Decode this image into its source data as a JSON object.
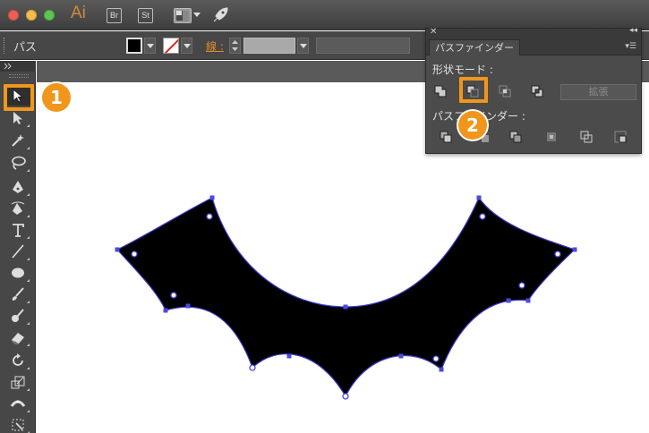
{
  "app": {
    "logo": "Ai",
    "bridge": "Br",
    "stock": "St"
  },
  "control": {
    "object_label": "パス",
    "stroke_label": "線 :"
  },
  "pathfinder": {
    "tab": "パスファインダー",
    "shape_modes_label": "形状モード :",
    "pathfinders_label": "パスファインダー :",
    "expand_label": "拡張",
    "shape_modes": [
      "unite",
      "minus-front",
      "intersect",
      "exclude"
    ],
    "pathfinder_ops": [
      "divide",
      "trim",
      "merge",
      "crop",
      "outline",
      "minus-back"
    ]
  },
  "callouts": {
    "one": "1",
    "two": "2"
  },
  "colors": {
    "accent": "#f0961c",
    "panel": "#4b4b4b",
    "path_stroke": "#3c3ccf",
    "fill": "#000000"
  },
  "tools": [
    "selection",
    "direct-selection",
    "magic-wand",
    "lasso",
    "pen",
    "curvature",
    "type",
    "line",
    "ellipse",
    "paintbrush",
    "blob-brush",
    "eraser",
    "rotate",
    "scale",
    "width",
    "free-transform"
  ]
}
